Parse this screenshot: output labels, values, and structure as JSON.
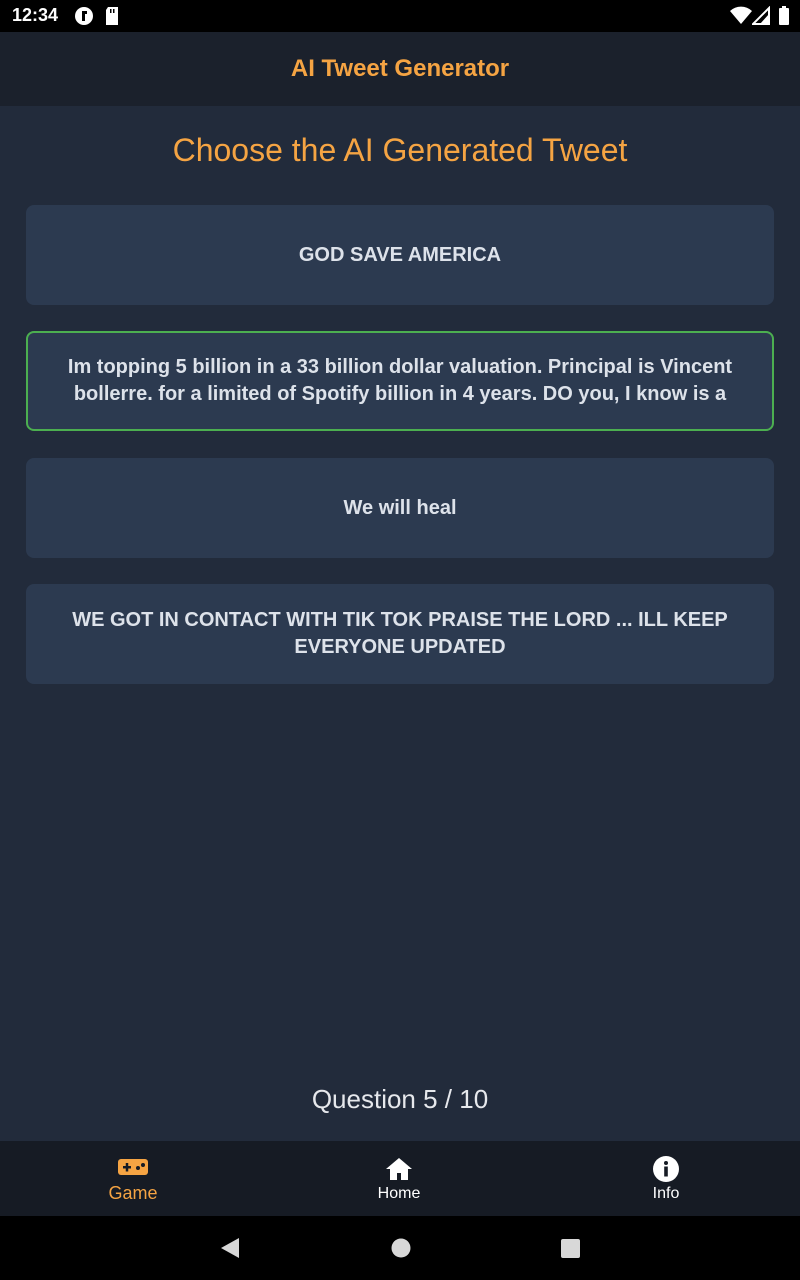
{
  "status_bar": {
    "time": "12:34",
    "icons": [
      "notification-f-icon",
      "sd-card-icon",
      "wifi-icon",
      "signal-icon",
      "battery-icon"
    ]
  },
  "app_bar": {
    "title": "AI Tweet Generator"
  },
  "main": {
    "heading": "Choose the AI Generated Tweet",
    "options": [
      {
        "text": "GOD SAVE AMERICA",
        "selected": false
      },
      {
        "text": "Im topping 5 billion in a 33 billion dollar valuation. Principal is Vincent bollerre. for a limited of Spotify billion in 4 years. DO you, I know is a",
        "selected": true
      },
      {
        "text": "We will heal",
        "selected": false
      },
      {
        "text": "WE GOT IN CONTACT WITH TIK TOK  PRAISE THE LORD ... ILL KEEP EVERYONE UPDATED",
        "selected": false
      }
    ],
    "question_counter": "Question 5 / 10"
  },
  "bottom_nav": {
    "items": [
      {
        "label": "Game",
        "icon": "gamepad-icon",
        "active": true
      },
      {
        "label": "Home",
        "icon": "home-icon",
        "active": false
      },
      {
        "label": "Info",
        "icon": "info-icon",
        "active": false
      }
    ]
  },
  "colors": {
    "accent": "#f5a443",
    "background": "#222b3b",
    "card": "#2c3a50",
    "selected_border": "#4caf50"
  }
}
